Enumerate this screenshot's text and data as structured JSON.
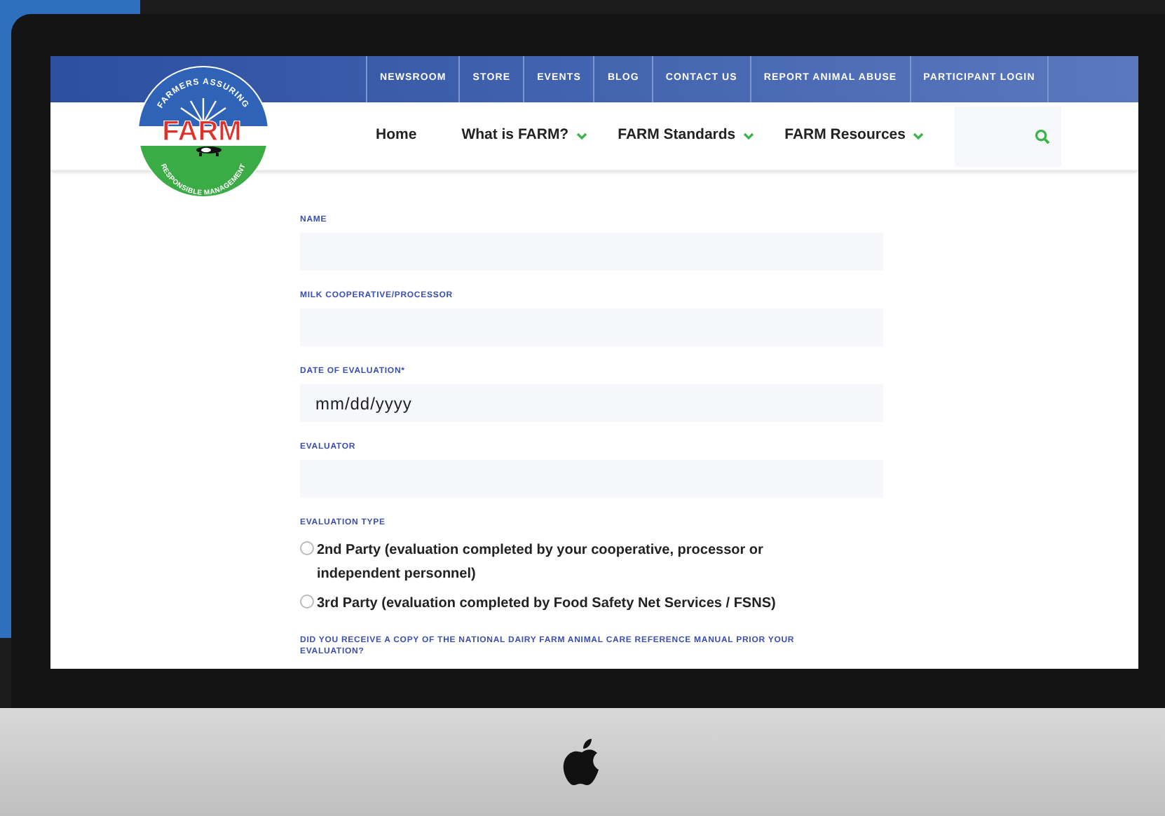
{
  "logo": {
    "title": "FARM",
    "arc_top": "FARMERS ASSURING",
    "arc_bottom": "RESPONSIBLE MANAGEMENT"
  },
  "top_links": [
    "NEWSROOM",
    "STORE",
    "EVENTS",
    "BLOG",
    "CONTACT US",
    "REPORT ANIMAL ABUSE",
    "PARTICIPANT LOGIN"
  ],
  "nav": [
    {
      "label": "Home",
      "has_menu": false
    },
    {
      "label": "What is FARM?",
      "has_menu": true
    },
    {
      "label": "FARM Standards",
      "has_menu": true
    },
    {
      "label": "FARM Resources",
      "has_menu": true
    }
  ],
  "form": [
    {
      "kind": "text",
      "label": "NAME"
    },
    {
      "kind": "text",
      "label": "MILK COOPERATIVE/PROCESSOR"
    },
    {
      "kind": "date",
      "label": "DATE OF EVALUATION*",
      "placeholder": "mm/dd/yyyy"
    },
    {
      "kind": "text",
      "label": "EVALUATOR"
    },
    {
      "kind": "radio",
      "label": "EVALUATION TYPE",
      "options": [
        {
          "label": "2nd Party (evaluation completed by your cooperative, processor or independent personnel)",
          "selected": false
        },
        {
          "label": "3rd Party (evaluation completed by Food Safety Net Services / FSNS)",
          "selected": false
        }
      ]
    },
    {
      "kind": "question",
      "label": "DID YOU RECEIVE A COPY OF THE NATIONAL DAIRY FARM ANIMAL CARE REFERENCE MANUAL PRIOR YOUR EVALUATION?"
    }
  ]
}
